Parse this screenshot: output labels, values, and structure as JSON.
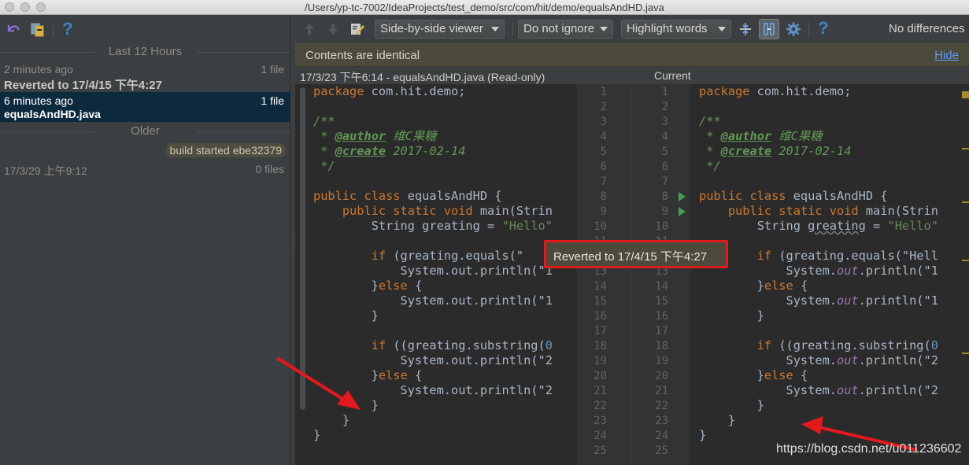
{
  "window": {
    "title": "/Users/yp-tc-7002/IdeaProjects/test_demo/src/com/hit/demo/equalsAndHD.java"
  },
  "left_toolbar": {
    "revert_icon": "undo-icon",
    "diff_icon": "show-diff-icon",
    "help_label": "?"
  },
  "history": {
    "group_recent": "Last 12 Hours",
    "group_older": "Older",
    "entries": [
      {
        "time": "2 minutes ago",
        "count": "1 file",
        "label": "Reverted to 17/4/15 下午4:27"
      },
      {
        "time": "6 minutes ago",
        "count": "1 file",
        "label": "equalsAndHD.java"
      },
      {
        "time": "17/3/29 上午9:12",
        "count": "0 files",
        "label": ""
      }
    ],
    "tag": "build started ebe32379"
  },
  "diff_toolbar": {
    "viewer": "Side-by-side viewer",
    "whitespace": "Do not ignore",
    "highlight": "Highlight words",
    "help_label": "?",
    "status": "No differences"
  },
  "notification": {
    "text": "Contents are identical",
    "hide": "Hide"
  },
  "files": {
    "left_title": "17/3/23 下午6:14 - equalsAndHD.java (Read-only)",
    "right_title": "Current"
  },
  "tooltip": "Reverted to 17/4/15 下午4:27",
  "watermark": "https://blog.csdn.net/u011236602",
  "gutter": {
    "left_lines": "1\n2\n3\n4\n5\n6\n7\n8\n9\n10\n11\n12\n13\n14\n15\n16\n17\n18\n19\n20\n21\n22\n23\n24\n25",
    "right_lines": "1\n2\n3\n4\n5\n6\n7\n8\n9\n10\n11\n12\n13\n14\n15\n16\n17\n18\n19\n20\n21\n22\n23\n24\n25"
  },
  "code": {
    "package_kw": "package",
    "package_name": " com.hit.demo;",
    "doc_open": "/**",
    "author_tag": "@author",
    "author_val": " 维C果糖",
    "create_tag": "@create",
    "create_val": " 2017-02-14",
    "doc_close": " */",
    "class_kw": "public class",
    "class_name": " equalsAndHD {",
    "main_kw": "public static void",
    "main_rest": " main(Strin",
    "string_decl": "String ",
    "var_name": "greating",
    "assign": " = ",
    "hello_l": "\"Hello\"",
    "hello_r": "\"Hello\"",
    "if_kw": "if",
    "if1_rest_l": " (greating.equals(\"",
    "if1_rest_r": " (greating.equals(\"Hell",
    "sys": "System.",
    "out": "out",
    "println1_l": ".println(\"1",
    "println1_r": ".println(\"1",
    "else_kw": "else",
    "if2_rest_l": " ((greating.substring(",
    "if2_rest_r": " ((greating.substring(",
    "zero": "0",
    "println2": ".println(\"2"
  }
}
